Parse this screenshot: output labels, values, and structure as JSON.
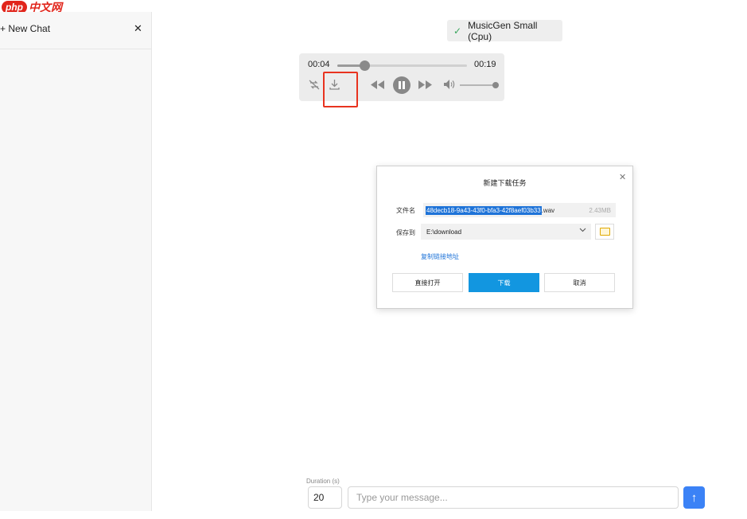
{
  "brand": {
    "logo_php": "php",
    "logo_cn": "中文网"
  },
  "sidebar": {
    "new_chat_label": "+ New Chat",
    "close_glyph": "✕"
  },
  "model": {
    "check_glyph": "✓",
    "name": "MusicGen Small (Cpu)"
  },
  "player": {
    "current_time": "00:04",
    "total_time": "00:19",
    "progress_fraction": 0.21,
    "volume_fraction": 1.0,
    "icons": [
      "repeat-off-icon",
      "download-icon",
      "rewind-icon",
      "pause-icon",
      "fast-forward-icon",
      "volume-icon"
    ]
  },
  "download_dialog": {
    "title": "新建下载任务",
    "close_glyph": "✕",
    "filename_label": "文件名",
    "filename_selected": "48decb18-9a43-43f0-bfa3-42f8aef03b33",
    "filename_ext": ".wav",
    "file_size": "2.43MB",
    "save_to_label": "保存到",
    "save_path": "E:\\download",
    "copy_link_label": "复制链接地址",
    "open_button": "直接打开",
    "download_button": "下载",
    "cancel_button": "取消"
  },
  "composer": {
    "duration_label": "Duration (s)",
    "duration_value": "20",
    "message_placeholder": "Type your message...",
    "send_glyph": "↑"
  },
  "colors": {
    "accent": "#3b82f6",
    "download_blue": "#1296e0",
    "highlight_red": "#e8331f",
    "check_green": "#3aa55d"
  }
}
